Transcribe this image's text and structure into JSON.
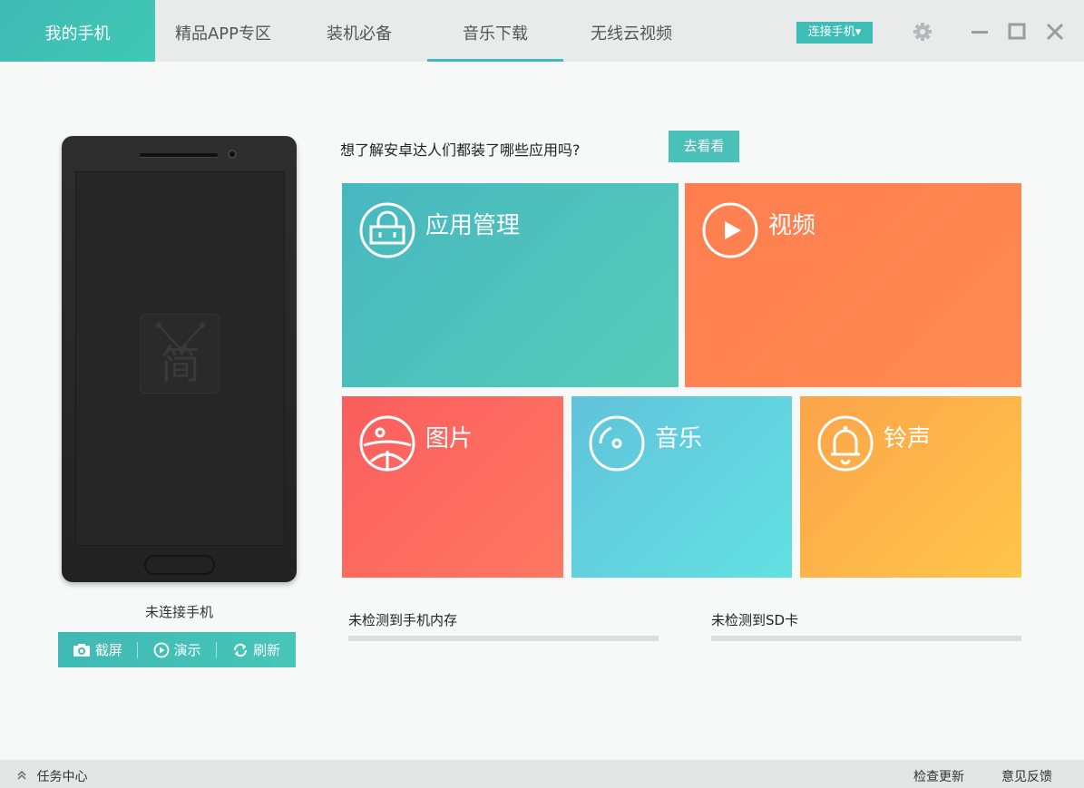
{
  "tabs": [
    {
      "label": "我的手机",
      "active": true
    },
    {
      "label": "精品APP专区",
      "active": false
    },
    {
      "label": "装机必备",
      "active": false
    },
    {
      "label": "音乐下载",
      "active": false,
      "underlined": true
    },
    {
      "label": "无线云视频",
      "active": false
    }
  ],
  "topbar": {
    "connect_label": "连接手机▾",
    "settings_icon": "gear-icon",
    "minimize_icon": "minimize-icon",
    "maximize_icon": "maximize-icon",
    "close_icon": "close-icon"
  },
  "phone": {
    "logo_char": "简",
    "status": "未连接手机",
    "actions": [
      {
        "icon": "camera-icon",
        "label": "截屏"
      },
      {
        "icon": "play-circle-icon",
        "label": "演示"
      },
      {
        "icon": "refresh-icon",
        "label": "刷新"
      }
    ]
  },
  "promo": {
    "question": "想了解安卓达人们都装了哪些应用吗?",
    "button": "去看看"
  },
  "tiles": {
    "apps": {
      "label": "应用管理",
      "icon": "shopping-bag-icon",
      "color": "#4fc1bb"
    },
    "video": {
      "label": "视频",
      "icon": "play-circle-icon",
      "color": "#ff8350"
    },
    "pictures": {
      "label": "图片",
      "icon": "picture-icon",
      "color": "#fd6b60"
    },
    "music": {
      "label": "音乐",
      "icon": "disc-icon",
      "color": "#62d2df"
    },
    "ringtone": {
      "label": "铃声",
      "icon": "bell-icon",
      "color": "#fdb54a"
    }
  },
  "storage": {
    "internal": {
      "label": "未检测到手机内存",
      "fill": 0
    },
    "sd": {
      "label": "未检测到SD卡",
      "fill": 0
    }
  },
  "bottom": {
    "task_center": "任务中心",
    "check_update": "检查更新",
    "feedback": "意见反馈"
  },
  "colors": {
    "accent": "#3dbdb6"
  }
}
